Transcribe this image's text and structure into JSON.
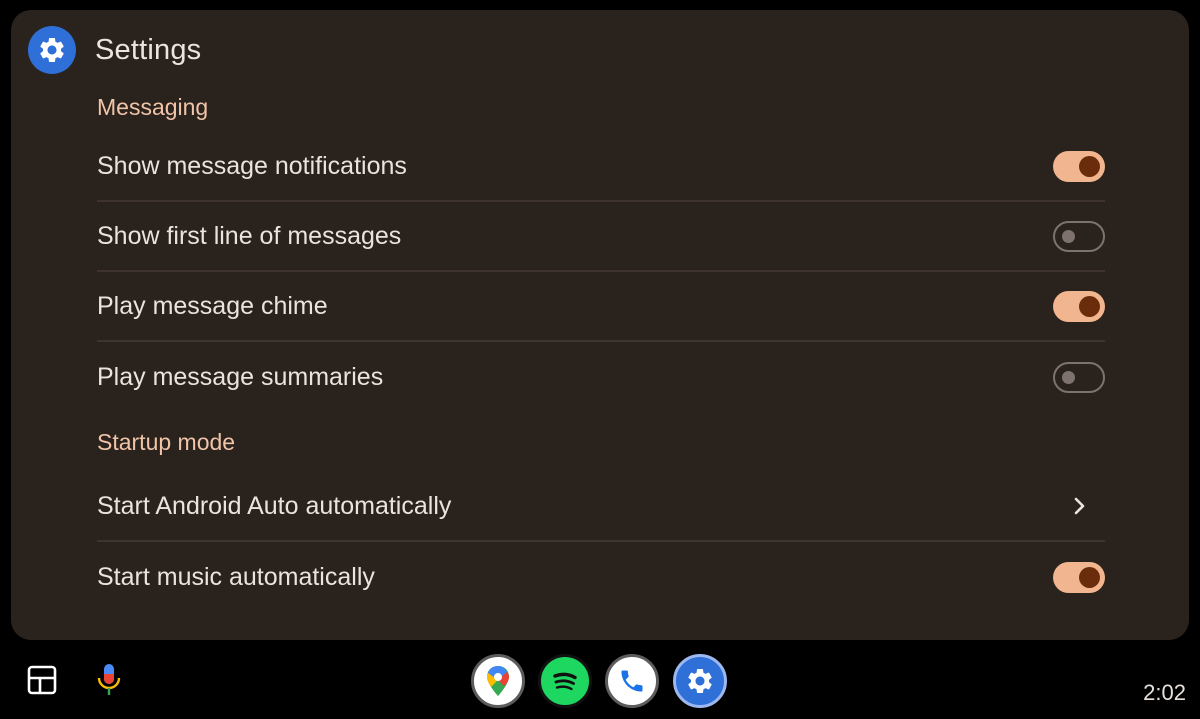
{
  "header": {
    "title": "Settings",
    "icon": "gear-icon"
  },
  "sections": [
    {
      "title": "Messaging",
      "items": [
        {
          "label": "Show message notifications",
          "control": "toggle",
          "on": true
        },
        {
          "label": "Show first line of messages",
          "control": "toggle",
          "on": false
        },
        {
          "label": "Play message chime",
          "control": "toggle",
          "on": true
        },
        {
          "label": "Play message summaries",
          "control": "toggle",
          "on": false
        }
      ]
    },
    {
      "title": "Startup mode",
      "items": [
        {
          "label": "Start Android Auto automatically",
          "control": "chevron-right-icon"
        },
        {
          "label": "Start music automatically",
          "control": "toggle",
          "on": true
        }
      ]
    }
  ],
  "dock": {
    "left_buttons": [
      "dashboard-icon",
      "microphone-icon"
    ],
    "apps": [
      "maps-icon",
      "spotify-icon",
      "phone-icon",
      "settings-icon"
    ],
    "clock": "2:02"
  },
  "colors": {
    "background": "#000000",
    "panel": "#2a221c",
    "accent_on_track": "#f1b58f",
    "accent_on_knob": "#6b2c0c",
    "section_header": "#f0c4a8",
    "text": "#ebe3dc",
    "divider": "#3e342d",
    "settings_blue": "#2f6fd8",
    "spotify_green": "#1ed760"
  }
}
